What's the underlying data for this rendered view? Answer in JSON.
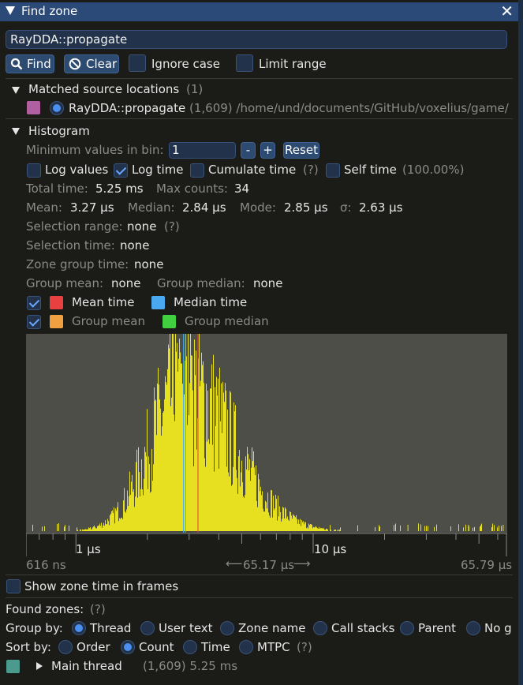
{
  "window": {
    "title": "Find zone",
    "close_glyph": "✕"
  },
  "search": {
    "value": "RayDDA::propagate"
  },
  "toolbar": {
    "find_label": "Find",
    "clear_label": "Clear",
    "ignore_case_label": "Ignore case",
    "limit_range_label": "Limit range"
  },
  "matched": {
    "header": "Matched source locations",
    "count": "(1)",
    "item_name": "RayDDA::propagate",
    "item_detail": "(1,609) /home/und/documents/GitHub/voxelius/game/",
    "item_color": "#b05fa0"
  },
  "histogram": {
    "header": "Histogram",
    "min_bin_label": "Minimum values in bin:",
    "min_bin_value": "1",
    "minus": "-",
    "plus": "+",
    "reset": "Reset",
    "log_values": "Log values",
    "log_time": "Log time",
    "cumulate_time": "Cumulate time",
    "help": "(?)",
    "self_time": "Self time",
    "self_time_pct": "(100.00%)",
    "total_time_label": "Total time:",
    "total_time": "5.25 ms",
    "max_counts_label": "Max counts:",
    "max_counts": "34",
    "mean_label": "Mean:",
    "mean": "3.27 µs",
    "median_label": "Median:",
    "median": "2.84 µs",
    "mode_label": "Mode:",
    "mode": "2.85 µs",
    "sigma_label": "σ:",
    "sigma": "2.63 µs",
    "selection_range_label": "Selection range:",
    "selection_range": "none",
    "selection_time_label": "Selection time:",
    "selection_time": "none",
    "zone_group_time_label": "Zone group time:",
    "zone_group_time": "none",
    "group_mean_label": "Group mean:",
    "group_mean": "none",
    "group_median_label": "Group median:",
    "group_median": "none",
    "legend": {
      "mean_time": "Mean time",
      "median_time": "Median time",
      "group_mean": "Group mean",
      "group_median": "Group median",
      "mean_color": "#e84040",
      "median_color": "#4aa8f0",
      "group_mean_color": "#f0a040",
      "group_median_color": "#40d040"
    },
    "axis": {
      "tick_1": "1 µs",
      "tick_10": "10 µs",
      "min": "616 ns",
      "range": "65.17 µs",
      "max": "65.79 µs"
    }
  },
  "chart_data": {
    "type": "bar",
    "x_scale": "log",
    "x_range_us": [
      0.616,
      65.79
    ],
    "y_max_count": 34,
    "bar_color": "#e6e020",
    "mean_us": 3.27,
    "median_us": 2.84
  },
  "bottom": {
    "show_zone_time": "Show zone time in frames",
    "found_zones": "Found zones:",
    "help": "(?)",
    "group_by_label": "Group by:",
    "group_by": [
      "Thread",
      "User text",
      "Zone name",
      "Call stacks",
      "Parent",
      "No g"
    ],
    "sort_by_label": "Sort by:",
    "sort_by": [
      "Order",
      "Count",
      "Time",
      "MTPC"
    ],
    "thread_name": "Main thread",
    "thread_detail": "(1,609) 5.25 ms",
    "thread_color": "#4a9a8e"
  }
}
